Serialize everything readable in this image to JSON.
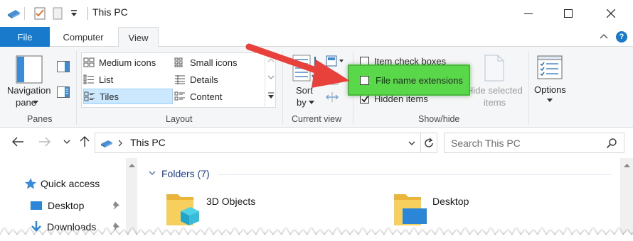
{
  "window": {
    "title": "This PC"
  },
  "tabs": {
    "file": "File",
    "computer": "Computer",
    "view": "View"
  },
  "ribbon": {
    "panes": {
      "navigation_pane_line1": "Navigation",
      "navigation_pane_line2": "pane",
      "group_label": "Panes"
    },
    "layout": {
      "items": [
        "Medium icons",
        "Small icons",
        "List",
        "Details",
        "Tiles",
        "Content"
      ],
      "selected": "Tiles",
      "group_label": "Layout"
    },
    "current_view": {
      "sort_line1": "Sort",
      "sort_line2": "by",
      "group_label": "Current view"
    },
    "show_hide": {
      "item_check_boxes": "Item check boxes",
      "file_name_extensions": "File name extensions",
      "hidden_items": "Hidden items",
      "hide_selected_line1": "Hide selected",
      "hide_selected_line2": "items",
      "group_label": "Show/hide",
      "item_check_boxes_checked": false,
      "file_name_extensions_checked": false,
      "hidden_items_checked": true
    },
    "options": {
      "label": "Options"
    }
  },
  "address": {
    "path": "This PC",
    "search_placeholder": "Search This PC"
  },
  "nav_pane": {
    "items": [
      "Quick access",
      "Desktop",
      "Downloads"
    ]
  },
  "main": {
    "section": "Folders (7)",
    "folders": [
      "3D Objects",
      "Desktop"
    ]
  },
  "colors": {
    "accent": "#1979ca",
    "highlight": "#59d94a",
    "annotation_arrow": "#e8413c",
    "selection": "#cce8ff"
  }
}
